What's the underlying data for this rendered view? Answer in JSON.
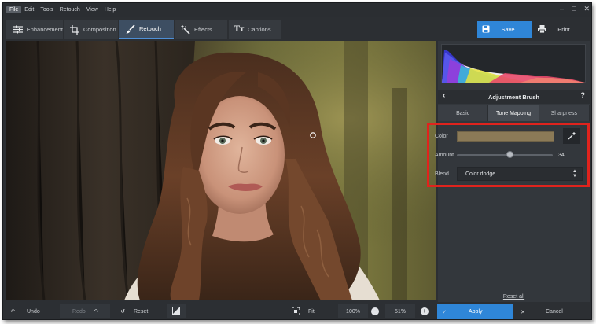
{
  "menu": {
    "items": [
      "File",
      "Edit",
      "Tools",
      "Retouch",
      "View",
      "Help"
    ],
    "active": "File"
  },
  "window": {
    "minimize": "–",
    "maximize": "□",
    "close": "✕"
  },
  "toolbar": {
    "tabs": [
      {
        "label": "Enhancement",
        "icon": "sliders-icon"
      },
      {
        "label": "Composition",
        "icon": "crop-icon"
      },
      {
        "label": "Retouch",
        "icon": "brush-icon",
        "active": true
      },
      {
        "label": "Effects",
        "icon": "magic-wand-icon"
      },
      {
        "label": "Captions",
        "icon": "text-tt-icon"
      }
    ],
    "save_label": "Save",
    "print_label": "Print"
  },
  "panel": {
    "title": "Adjustment Brush",
    "help": "?",
    "subtabs": [
      "Basic",
      "Tone Mapping",
      "Sharpness"
    ],
    "active_subtab": "Tone Mapping",
    "color_label": "Color",
    "color_value": "#8b7a57",
    "amount_label": "Amount",
    "amount_value": "34",
    "amount_fraction": 0.55,
    "blend_label": "Blend",
    "blend_value": "Color dodge",
    "reset_all": "Reset all"
  },
  "bottom": {
    "undo": "Undo",
    "redo": "Redo",
    "reset": "Reset",
    "fit": "Fit",
    "zoom_100": "100%",
    "zoom_value": "51%",
    "apply": "Apply",
    "cancel": "Cancel"
  },
  "colors": {
    "accent": "#2f86d8",
    "highlight_box": "#e0231d",
    "background": "#2c2f33"
  }
}
